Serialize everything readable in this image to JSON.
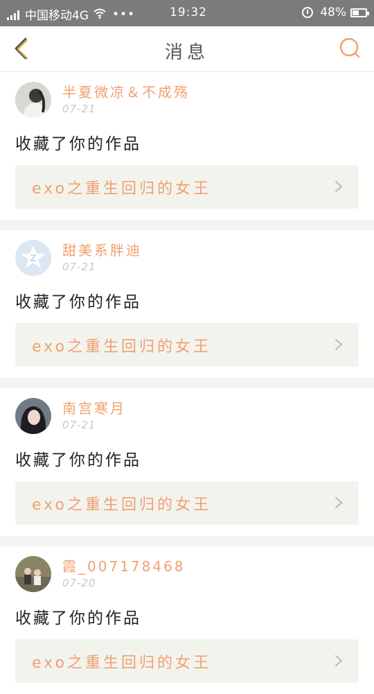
{
  "status_bar": {
    "carrier": "中国移动4G",
    "dots": "•••",
    "time": "19:32",
    "battery_percent": "48%",
    "battery_level": 0.48
  },
  "nav": {
    "title": "消息",
    "back_icon": "chevron-left-icon",
    "search_icon": "search-icon",
    "accent_color": "#f0a070"
  },
  "messages": [
    {
      "username": "半夏微凉＆不成殇",
      "date": "07-21",
      "action": "收藏了你的作品",
      "work_title": "exo之重生回归的女王"
    },
    {
      "username": "甜美系胖迪",
      "date": "07-21",
      "action": "收藏了你的作品",
      "work_title": "exo之重生回归的女王"
    },
    {
      "username": "南宫寒月",
      "date": "07-21",
      "action": "收藏了你的作品",
      "work_title": "exo之重生回归的女王"
    },
    {
      "username": "霞_007178468",
      "date": "07-20",
      "action": "收藏了你的作品",
      "work_title": "exo之重生回归的女王"
    }
  ]
}
